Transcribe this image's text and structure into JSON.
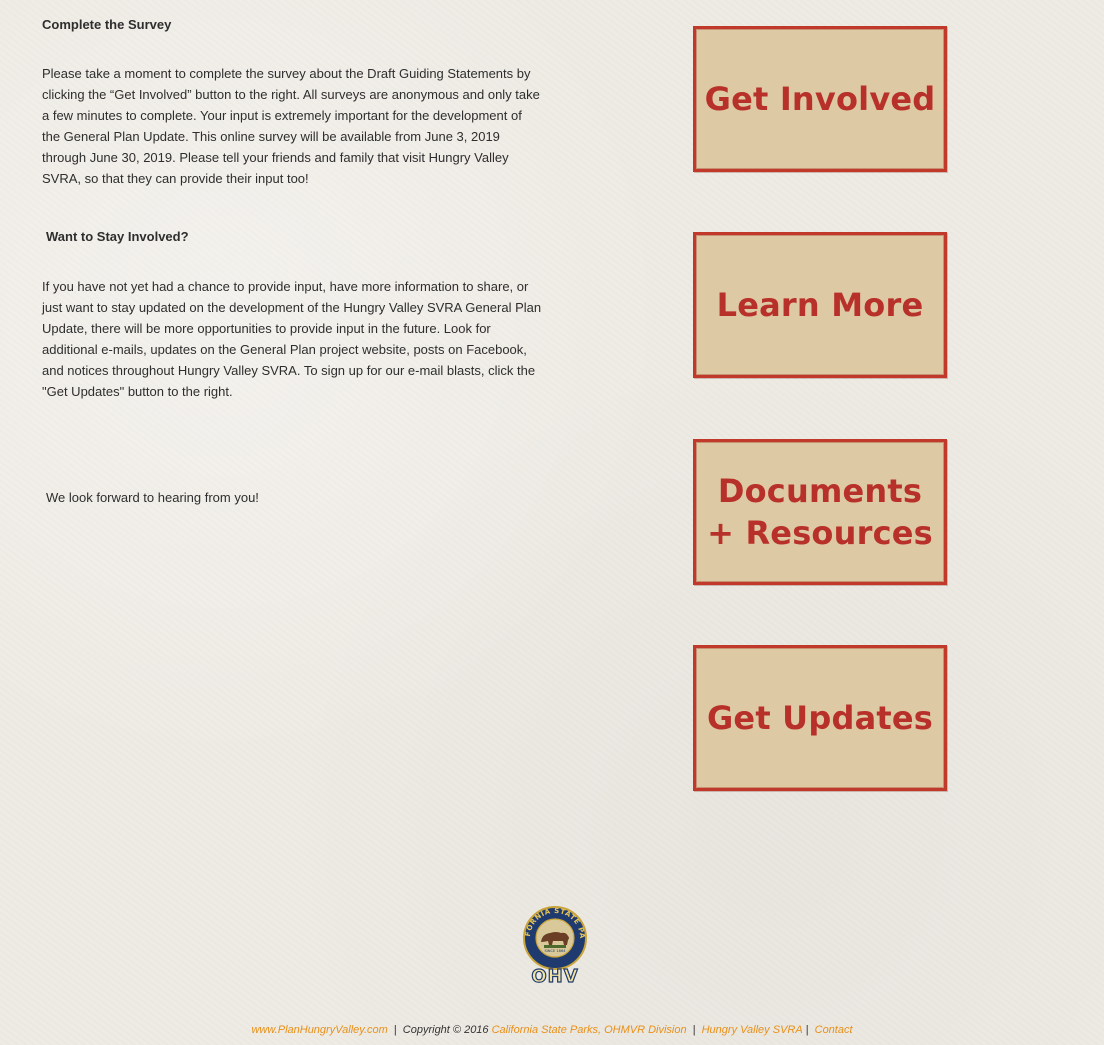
{
  "survey": {
    "heading": "Complete the Survey",
    "body": "Please take a moment to complete the survey about the Draft Guiding Statements by clicking the “Get Involved” button to the right. All surveys are anonymous and only take a few minutes to complete. Your input is extremely important for the development of the General Plan Update. This online survey will be available from June 3, 2019 through June 30, 2019. Please tell your friends and family that visit Hungry Valley SVRA, so that they can provide their input too!"
  },
  "involved": {
    "heading": "Want to Stay Involved?",
    "body": "If you have not yet had a chance to provide input, have more information to share, or just want to stay updated on the development of the Hungry Valley SVRA General Plan Update, there will be more opportunities to provide input in the future. Look for additional e-mails, updates on the General Plan project website, posts on Facebook, and notices throughout Hungry Valley SVRA. To sign up for our e-mail blasts, click the \"Get Updates\" button to the right."
  },
  "closing": "We look forward to hearing from you!",
  "buttons": {
    "get_involved": "Get Involved",
    "learn_more": "Learn More",
    "documents": "Documents\n+ Resources",
    "get_updates": "Get Updates"
  },
  "logo": {
    "ring_text": "CALIFORNIA STATE PARKS",
    "center_text": "SINCE 1864",
    "wordmark": "OHV"
  },
  "footer": {
    "site_link": "www.PlanHungryValley.com",
    "copyright": "Copyright © 2016",
    "agency_link": "California State Parks, OHMVR Division",
    "svra_link": "Hungry Valley SVRA",
    "contact_link": "Contact",
    "separator": "|"
  },
  "colors": {
    "button_fill": "#ddc9a4",
    "button_border": "#c0392b",
    "button_text": "#b8302a",
    "footer_link": "#e8901a",
    "background": "#eeebe4"
  }
}
